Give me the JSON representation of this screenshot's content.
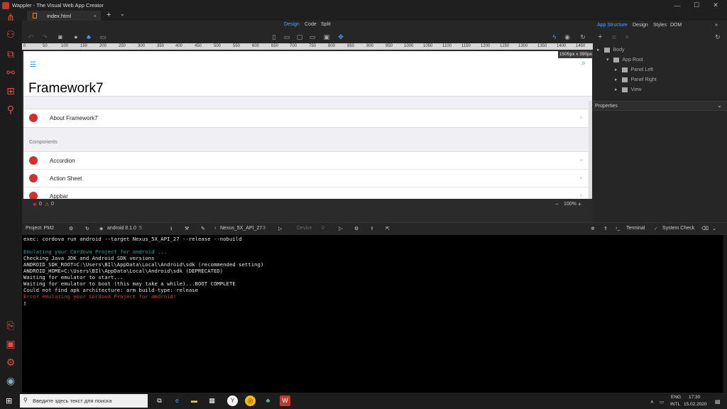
{
  "window": {
    "title": "Wappler - The Visual Web App Creator",
    "minimize": "—",
    "maximize": "☐",
    "close": "✕"
  },
  "tabs": {
    "active": "index.html",
    "add": "+",
    "dropdown": "⌄"
  },
  "modes": {
    "design": "Design",
    "code": "Code",
    "split": "Split"
  },
  "right_tabs": {
    "app_structure": "App Structure",
    "design": "Design",
    "styles": "Styles",
    "dom": "DOM",
    "more": "»"
  },
  "ruler": {
    "ticks": [
      "0",
      "50",
      "100",
      "150",
      "200",
      "250",
      "300",
      "350",
      "400",
      "450",
      "500",
      "550",
      "600",
      "650",
      "700",
      "750",
      "800",
      "850",
      "900",
      "950",
      "1000",
      "1050",
      "1100",
      "1150",
      "1200",
      "1250",
      "1300",
      "1350",
      "1400",
      "1450"
    ],
    "size_badge": "1505px x 390px"
  },
  "preview": {
    "menu_icon": "☰",
    "search_icon": "⌕",
    "large_title": "Framework7",
    "items_top": [
      {
        "label": "About Framework7"
      }
    ],
    "block_title": "Components",
    "items_components": [
      {
        "label": "Accordion"
      },
      {
        "label": "Action Sheet"
      },
      {
        "label": "Appbar"
      }
    ],
    "chevron": "›"
  },
  "status": {
    "errors": "0",
    "warnings": "0",
    "zoom": "100%",
    "zoom_minus": "−",
    "zoom_plus": "+"
  },
  "structure_tree": {
    "body": "Body",
    "app_root": "App Root",
    "panel_left": "Panel Left",
    "panel_right": "Panel Right",
    "view": "View"
  },
  "properties": {
    "label": "Properties"
  },
  "bottom_bar": {
    "project": "Project: PM2",
    "platform": "android 8.1.0",
    "platform_count": "5",
    "emulator": "Nexus_5X_API_27",
    "emulator_count": "3",
    "device": "Device",
    "device_count": "0",
    "terminal": "Terminal",
    "system_check": "System Check"
  },
  "terminal": {
    "lines": [
      {
        "text": "exec: cordova run android --target Nexus_5X_API_27 --release --nobuild",
        "color": "#e6e6e6"
      },
      {
        "text": "",
        "color": "#e6e6e6"
      },
      {
        "text": "Emulating your Cordova Project for android ...",
        "color": "#2aa3a3"
      },
      {
        "text": "Checking Java JDK and Android SDK versions",
        "color": "#e6e6e6"
      },
      {
        "text": "ANDROID_SDK_ROOT=C:\\Users\\BIl\\AppData\\Local\\Android\\sdk (recommended setting)",
        "color": "#e6e6e6"
      },
      {
        "text": "ANDROID_HOME=C:\\Users\\BIl\\AppData\\Local\\Android\\sdk (DEPRECATED)",
        "color": "#e6e6e6"
      },
      {
        "text": "Waiting for emulator to start...",
        "color": "#e6e6e6"
      },
      {
        "text": "Waiting for emulator to boot (this may take a while)...BOOT COMPLETE",
        "color": "#e6e6e6"
      },
      {
        "text": "Could not find apk architecture: arm build-type: release",
        "color": "#e6e6e6"
      },
      {
        "text": "Error emulating your Cordova Project for android!",
        "color": "#d93a3a"
      }
    ],
    "cursor": "▯"
  },
  "taskbar": {
    "search_placeholder": "Введите здесь текст для поиска",
    "lang": "ENG",
    "lang2": "INTL",
    "time": "17:30",
    "date": "15.02.2020"
  },
  "colors": {
    "accent": "#2196f3",
    "brand": "#e74c3c",
    "error": "#d93a3a",
    "info": "#2aa3a3"
  }
}
